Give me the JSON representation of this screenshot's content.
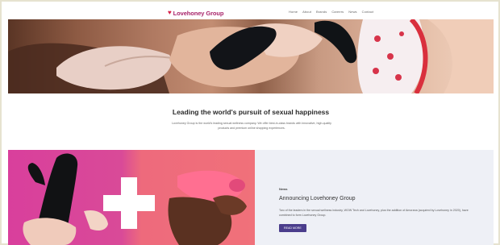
{
  "brand": {
    "name": "Lovehoney Group",
    "color": "#a8246a",
    "heart_color": "#d8204a"
  },
  "nav": {
    "items": [
      {
        "label": "Home"
      },
      {
        "label": "About"
      },
      {
        "label": "Brands"
      },
      {
        "label": "Careers"
      },
      {
        "label": "News"
      },
      {
        "label": "Contact"
      }
    ]
  },
  "intro": {
    "title": "Leading the world's pursuit of sexual happiness",
    "body": "Lovehoney Group is the world's leading sexual wellness company. We offer best-in-class brands with innovative, high-quality products and premium online shopping experiences."
  },
  "news": {
    "tag": "News",
    "title": "Announcing Lovehoney Group",
    "body": "Two of the leaders in the sexual wellness industry, WOW Tech and Lovehoney, plus the addition of Amorana (acquired by Lovehoney in 2020), have combined to form Lovehoney Group.",
    "button_label": "READ MORE",
    "button_color": "#4a3d8c"
  }
}
